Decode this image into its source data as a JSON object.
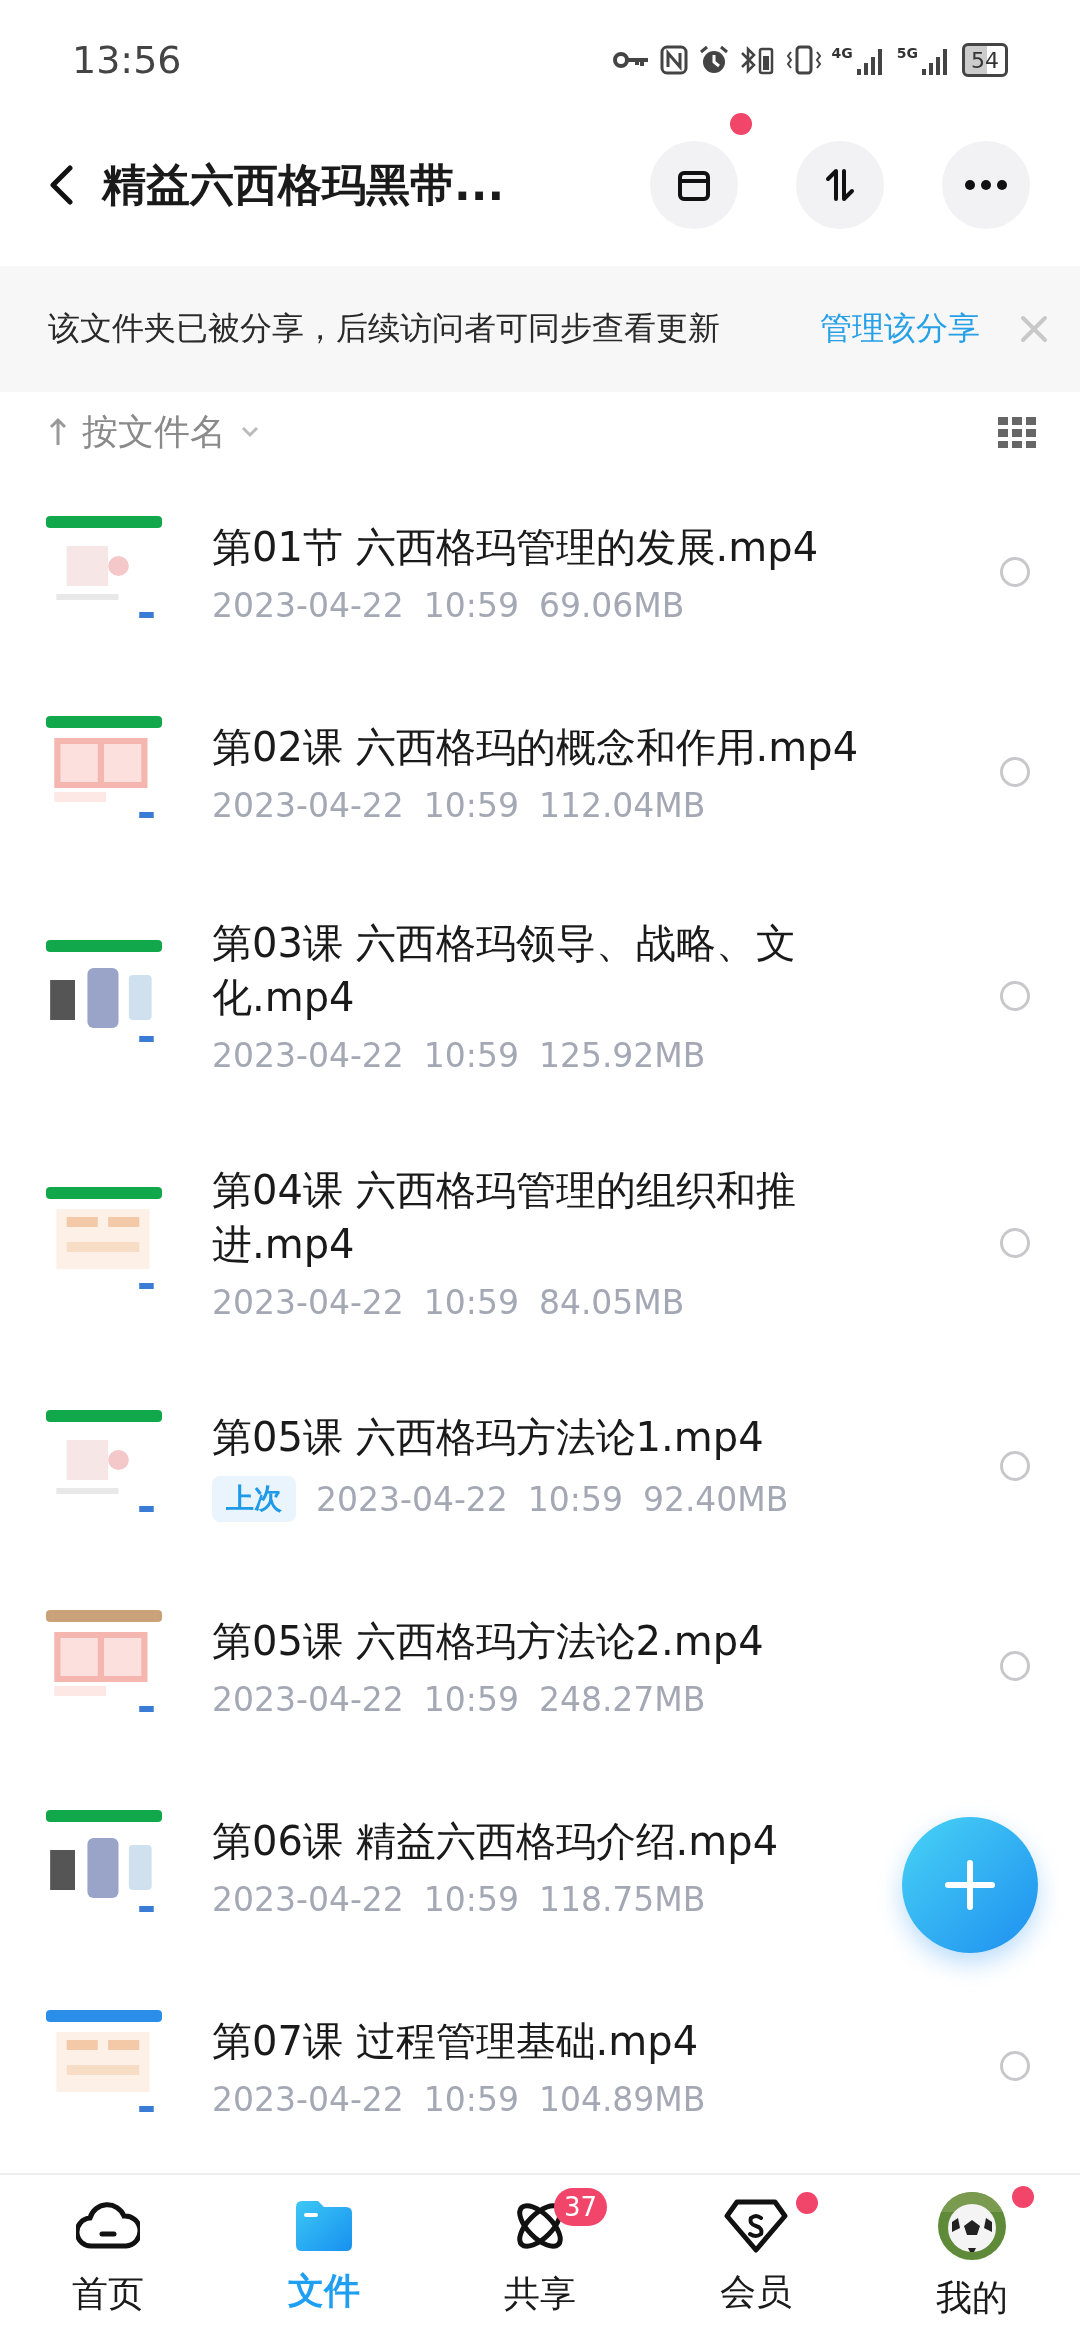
{
  "status_bar": {
    "time": "13:56",
    "networks": [
      "4G",
      "5G"
    ],
    "battery": "54"
  },
  "header": {
    "title": "精益六西格玛黑带...",
    "actions": [
      {
        "kind": "archive",
        "dot": true
      },
      {
        "kind": "sort"
      },
      {
        "kind": "more"
      }
    ]
  },
  "banner": {
    "text": "该文件夹已被分享，后续访问者可同步查看更新",
    "link": "管理该分享"
  },
  "sort": {
    "label": "按文件名"
  },
  "files": [
    {
      "title": "第01节 六西格玛管理的发展.mp4",
      "date": "2023-04-22",
      "time": "10:59",
      "size": "69.06MB",
      "selected": false
    },
    {
      "title": "第02课 六西格玛的概念和作用.mp4",
      "date": "2023-04-22",
      "time": "10:59",
      "size": "112.04MB",
      "selected": false
    },
    {
      "title": "第03课 六西格玛领导、战略、文化.mp4",
      "date": "2023-04-22",
      "time": "10:59",
      "size": "125.92MB",
      "selected": false
    },
    {
      "title": "第04课 六西格玛管理的组织和推进.mp4",
      "date": "2023-04-22",
      "time": "10:59",
      "size": "84.05MB",
      "selected": false
    },
    {
      "title": "第05课 六西格玛方法论1.mp4",
      "badge": "上次",
      "date": "2023-04-22",
      "time": "10:59",
      "size": "92.40MB",
      "selected": false
    },
    {
      "title": "第05课 六西格玛方法论2.mp4",
      "date": "2023-04-22",
      "time": "10:59",
      "size": "248.27MB",
      "selected": false
    },
    {
      "title": "第06课 精益六西格玛介绍.mp4",
      "date": "2023-04-22",
      "time": "10:59",
      "size": "118.75MB"
    },
    {
      "title": "第07课 过程管理基础.mp4",
      "date": "2023-04-22",
      "time": "10:59",
      "size": "104.89MB",
      "selected": false
    }
  ],
  "nav": [
    {
      "kind": "home",
      "label": "首页",
      "selected": false
    },
    {
      "kind": "files",
      "label": "文件",
      "selected": true
    },
    {
      "kind": "share",
      "label": "共享",
      "selected": false,
      "badge": "37"
    },
    {
      "kind": "vip",
      "label": "会员",
      "selected": false,
      "dot": true
    },
    {
      "kind": "me",
      "label": "我的",
      "selected": false,
      "dot": true
    }
  ]
}
